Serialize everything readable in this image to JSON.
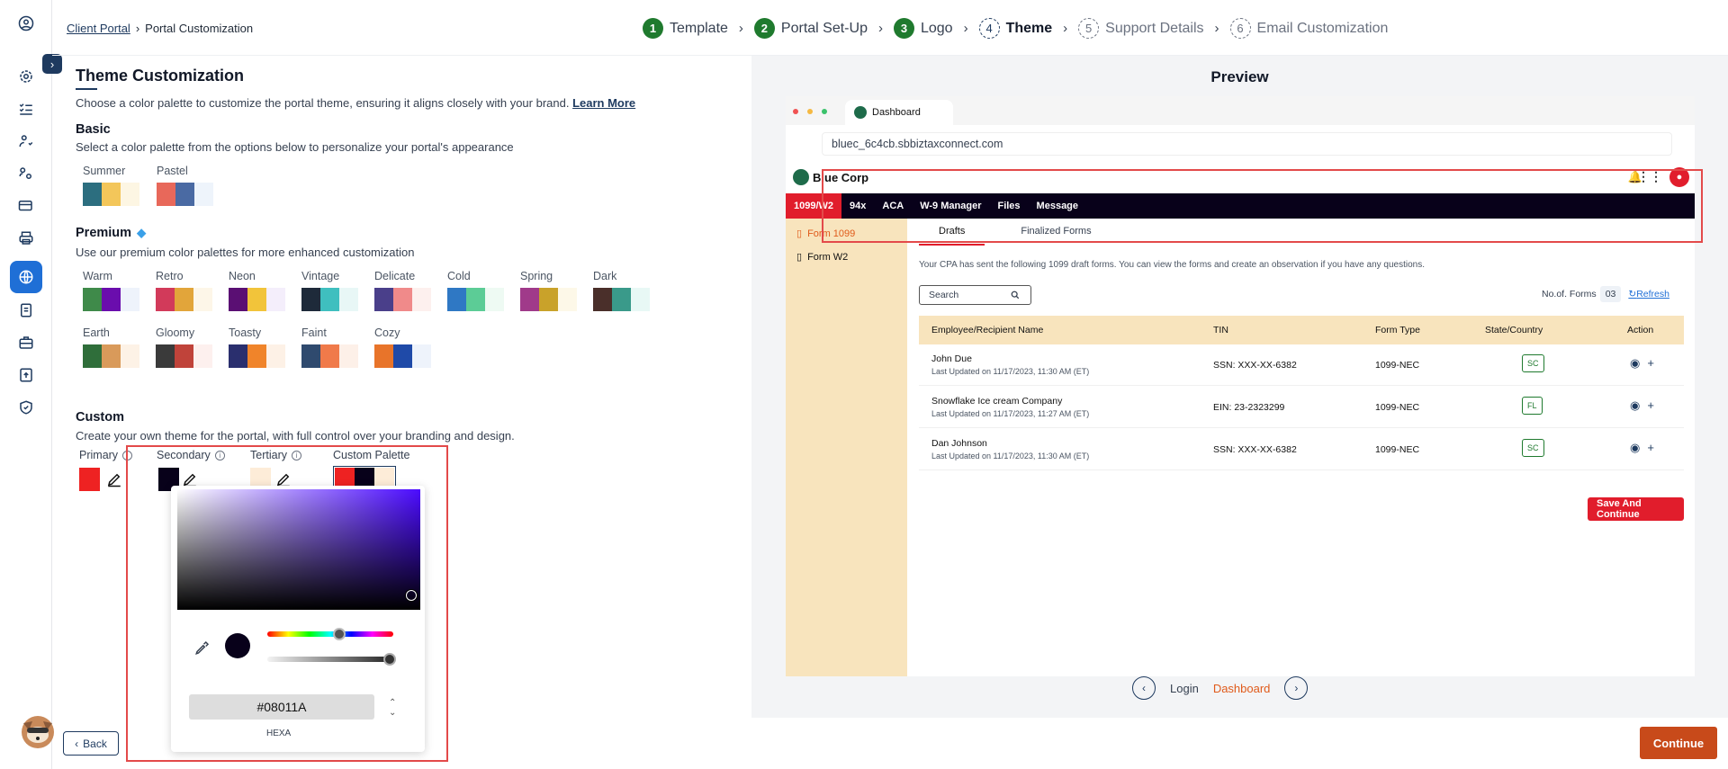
{
  "breadcrumb": {
    "root": "Client Portal",
    "current": "Portal Customization"
  },
  "stepper": [
    {
      "num": "1",
      "label": "Template",
      "state": "done"
    },
    {
      "num": "2",
      "label": "Portal Set-Up",
      "state": "done"
    },
    {
      "num": "3",
      "label": "Logo",
      "state": "done"
    },
    {
      "num": "4",
      "label": "Theme",
      "state": "current"
    },
    {
      "num": "5",
      "label": "Support Details",
      "state": "todo"
    },
    {
      "num": "6",
      "label": "Email Customization",
      "state": "todo"
    }
  ],
  "theme": {
    "title": "Theme Customization",
    "intro": "Choose a color palette to customize the portal theme, ensuring it aligns closely with your brand.",
    "learn_more": "Learn More",
    "basic_title": "Basic",
    "basic_desc": "Select a color palette from the options below to personalize your portal's appearance",
    "basic": [
      {
        "name": "Summer",
        "colors": [
          "#2c6e7f",
          "#f3c65a",
          "#fdf6e3"
        ]
      },
      {
        "name": "Pastel",
        "colors": [
          "#e8685a",
          "#4a6aa3",
          "#eef4fb"
        ]
      }
    ],
    "premium_title": "Premium",
    "premium_desc": "Use our premium color palettes for more enhanced customization",
    "premium": [
      {
        "name": "Warm",
        "colors": [
          "#3f8a4a",
          "#6a0dad",
          "#eef3fb"
        ]
      },
      {
        "name": "Retro",
        "colors": [
          "#d23a5a",
          "#e2a53a",
          "#fdf6e8"
        ]
      },
      {
        "name": "Neon",
        "colors": [
          "#5a0f73",
          "#f2c43a",
          "#f4eefb"
        ]
      },
      {
        "name": "Vintage",
        "colors": [
          "#1e2a3a",
          "#3fbfbf",
          "#e8f7f6"
        ]
      },
      {
        "name": "Delicate",
        "colors": [
          "#4a3f8a",
          "#f08a8a",
          "#fdf0ee"
        ]
      },
      {
        "name": "Cold",
        "colors": [
          "#2f78c4",
          "#5ccc96",
          "#eefaf3"
        ]
      },
      {
        "name": "Spring",
        "colors": [
          "#a03a8a",
          "#c9a22a",
          "#fdf8e8"
        ]
      },
      {
        "name": "Dark",
        "colors": [
          "#4a2f2a",
          "#3a9a8a",
          "#e8f8f5"
        ]
      },
      {
        "name": "Earth",
        "colors": [
          "#2f6e3a",
          "#d99a5a",
          "#fdf2e6"
        ]
      },
      {
        "name": "Gloomy",
        "colors": [
          "#3a3a3a",
          "#c0433a",
          "#fdf0ee"
        ]
      },
      {
        "name": "Toasty",
        "colors": [
          "#2a2f6e",
          "#f0842a",
          "#fdf1e6"
        ]
      },
      {
        "name": "Faint",
        "colors": [
          "#2f4a6e",
          "#f07a4a",
          "#fdf0e8"
        ]
      },
      {
        "name": "Cozy",
        "colors": [
          "#e8742a",
          "#1f4aa8",
          "#eef3fb"
        ]
      }
    ],
    "custom_title": "Custom",
    "custom_desc": "Create your own theme for the portal, with full control over your branding and design.",
    "custom": {
      "primary_label": "Primary",
      "primary_color": "#ee2222",
      "secondary_label": "Secondary",
      "secondary_color": "#08011A",
      "tertiary_label": "Tertiary",
      "tertiary_color": "#fdecd8",
      "palette_label": "Custom Palette"
    }
  },
  "picker": {
    "hex": "#08011A",
    "mode": "HEXA",
    "hue": 0.57,
    "alpha": 0.97
  },
  "back_label": "Back",
  "continue_label": "Continue",
  "preview": {
    "title": "Preview",
    "tab_title": "Dashboard",
    "url": "bluec_6c4cb.sbbiztaxconnect.com",
    "company": "Blue Corp",
    "nav": [
      "1099/W2",
      "94x",
      "ACA",
      "W-9 Manager",
      "Files",
      "Message"
    ],
    "side": [
      "Form 1099",
      "Form W2"
    ],
    "tabs": [
      "Drafts",
      "Finalized Forms"
    ],
    "desc": "Your CPA has sent the following 1099 draft forms. You can view the forms and create an observation if you have any questions.",
    "search_placeholder": "Search",
    "forms_label": "No.of. Forms",
    "forms_count": "03",
    "refresh": "Refresh",
    "columns": [
      "Employee/Recipient Name",
      "TIN",
      "Form Type",
      "State/Country",
      "Action"
    ],
    "rows": [
      {
        "name": "John Due",
        "updated": "Last Updated on 11/17/2023, 11:30 AM (ET)",
        "tin": "SSN: XXX-XX-6382",
        "form": "1099-NEC",
        "state": "SC"
      },
      {
        "name": "Snowflake Ice cream Company",
        "updated": "Last Updated on 11/17/2023, 11:27 AM (ET)",
        "tin": "EIN: 23-2323299",
        "form": "1099-NEC",
        "state": "FL"
      },
      {
        "name": "Dan Johnson",
        "updated": "Last Updated on 11/17/2023, 11:30 AM (ET)",
        "tin": "SSN: XXX-XX-6382",
        "form": "1099-NEC",
        "state": "SC"
      }
    ],
    "save_label": "Save And Continue",
    "page_login": "Login",
    "page_dashboard": "Dashboard"
  }
}
